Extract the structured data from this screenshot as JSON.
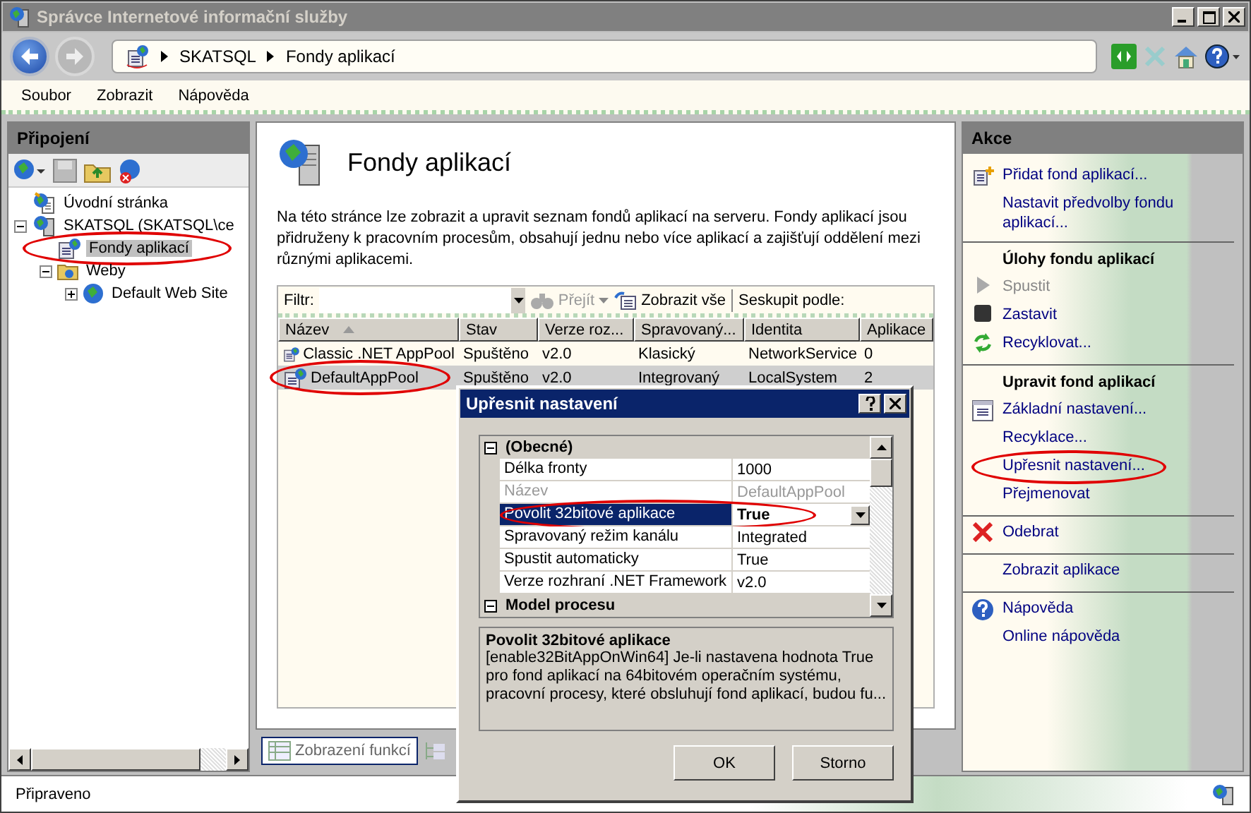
{
  "window": {
    "title": "Správce Internetové informační služby"
  },
  "address_bar": {
    "breadcrumb": [
      "SKATSQL",
      "Fondy aplikací"
    ]
  },
  "menu": [
    "Soubor",
    "Zobrazit",
    "Nápověda"
  ],
  "connections": {
    "title": "Připojení",
    "tree": [
      {
        "label": "Úvodní stránka",
        "kind": "home",
        "selected": false,
        "circled": false
      },
      {
        "label": "SKATSQL (SKATSQL\\ce",
        "kind": "server",
        "expanded": true,
        "selected": false,
        "circled": false,
        "children": [
          {
            "label": "Fondy aplikací",
            "kind": "pools",
            "selected": true,
            "circled": true
          },
          {
            "label": "Weby",
            "kind": "folder",
            "expanded": true,
            "selected": false,
            "circled": false,
            "children": [
              {
                "label": "Default Web Site",
                "kind": "site",
                "expanded": false,
                "selected": false,
                "circled": false
              }
            ]
          }
        ]
      }
    ]
  },
  "page": {
    "title": "Fondy aplikací",
    "description": "Na této stránce lze zobrazit a upravit seznam fondů aplikací na serveru. Fondy aplikací jsou přidruženy k pracovním procesům, obsahují jednu nebo více aplikací a zajišťují oddělení mezi různými aplikacemi.",
    "filter": {
      "label": "Filtr:",
      "go": "Přejít",
      "show_all": "Zobrazit vše",
      "group_by": "Seskupit podle:"
    },
    "table": {
      "columns": [
        {
          "label": "Název",
          "sorted": true
        },
        {
          "label": "Stav",
          "sorted": false
        },
        {
          "label": "Verze roz...",
          "sorted": false
        },
        {
          "label": "Spravovaný...",
          "sorted": false
        },
        {
          "label": "Identita",
          "sorted": false
        },
        {
          "label": "Aplikace",
          "sorted": false
        }
      ],
      "rows": [
        {
          "cells": [
            "Classic .NET AppPool",
            "Spuštěno",
            "v2.0",
            "Klasický",
            "NetworkService",
            "0"
          ],
          "selected": false,
          "circled": false
        },
        {
          "cells": [
            "DefaultAppPool",
            "Spuštěno",
            "v2.0",
            "Integrovaný",
            "LocalSystem",
            "2"
          ],
          "selected": true,
          "circled": true
        }
      ]
    },
    "views": [
      {
        "label": "Zobrazení funkcí",
        "selected": true
      }
    ]
  },
  "actions": {
    "title": "Akce",
    "groups": [
      {
        "items": [
          {
            "label": "Přidat fond aplikací...",
            "kind": "add",
            "disabled": false,
            "circled": false
          },
          {
            "label": "Nastavit předvolby fondu aplikací...",
            "kind": "plain",
            "disabled": false,
            "circled": false
          }
        ]
      },
      {
        "title": "Úlohy fondu aplikací",
        "items": [
          {
            "label": "Spustit",
            "kind": "start",
            "disabled": true,
            "circled": false
          },
          {
            "label": "Zastavit",
            "kind": "stop",
            "disabled": false,
            "circled": false
          },
          {
            "label": "Recyklovat...",
            "kind": "recycle",
            "disabled": false,
            "circled": false
          }
        ]
      },
      {
        "title": "Upravit fond aplikací",
        "items": [
          {
            "label": "Základní nastavení...",
            "kind": "settings",
            "disabled": false,
            "circled": false
          },
          {
            "label": "Recyklace...",
            "kind": "plain",
            "disabled": false,
            "circled": false
          },
          {
            "label": "Upřesnit nastavení...",
            "kind": "plain",
            "disabled": false,
            "circled": true
          },
          {
            "label": "Přejmenovat",
            "kind": "plain",
            "disabled": false,
            "circled": false
          }
        ]
      },
      {
        "items": [
          {
            "label": "Odebrat",
            "kind": "remove",
            "disabled": false,
            "circled": false
          }
        ]
      },
      {
        "items": [
          {
            "label": "Zobrazit aplikace",
            "kind": "plain",
            "disabled": false,
            "circled": false
          }
        ]
      },
      {
        "items": [
          {
            "label": "Nápověda",
            "kind": "help",
            "disabled": false,
            "circled": false
          },
          {
            "label": "Online nápověda",
            "kind": "plain",
            "disabled": false,
            "circled": false
          }
        ]
      }
    ]
  },
  "dialog": {
    "title": "Upřesnit nastavení",
    "categories": [
      {
        "label": "(Obecné)",
        "expanded": true,
        "properties": [
          {
            "name": "Délka fronty",
            "value": "1000",
            "disabled": false,
            "selected": false,
            "circled": false
          },
          {
            "name": "Název",
            "value": "DefaultAppPool",
            "disabled": true,
            "selected": false,
            "circled": false
          },
          {
            "name": "Povolit 32bitové aplikace",
            "value": "True",
            "disabled": false,
            "selected": true,
            "circled": true
          },
          {
            "name": "Spravovaný režim kanálu",
            "value": "Integrated",
            "disabled": false,
            "selected": false,
            "circled": false
          },
          {
            "name": "Spustit automaticky",
            "value": "True",
            "disabled": false,
            "selected": false,
            "circled": false
          },
          {
            "name": "Verze rozhraní .NET Framework",
            "value": "v2.0",
            "disabled": false,
            "selected": false,
            "circled": false
          }
        ]
      },
      {
        "label": "Model procesu",
        "expanded": true
      }
    ],
    "description": {
      "title": "Povolit 32bitové aplikace",
      "text": "[enable32BitAppOnWin64] Je-li nastavena hodnota True pro fond aplikací na 64bitovém operačním systému, pracovní procesy, které obsluhují fond aplikací, budou fu..."
    },
    "buttons": [
      "OK",
      "Storno"
    ]
  },
  "status_bar": {
    "text": "Připraveno"
  }
}
